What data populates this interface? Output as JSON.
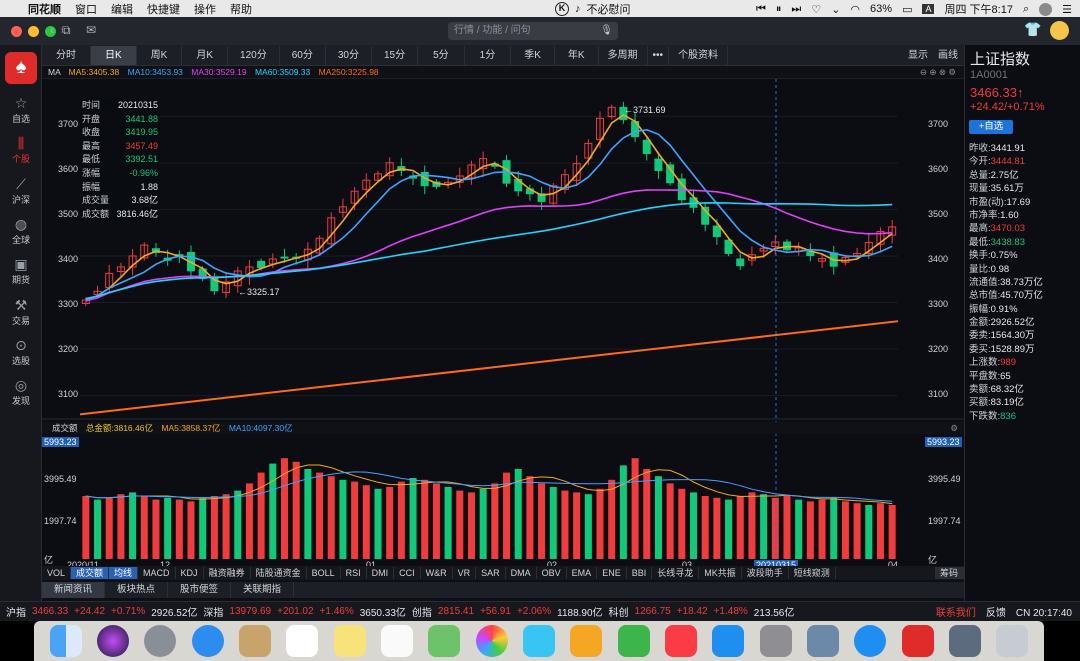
{
  "menubar": {
    "app": "同花顺",
    "items": [
      "窗口",
      "编辑",
      "快捷键",
      "操作",
      "帮助"
    ],
    "center_text": "不必慰问",
    "battery": "63%",
    "input_method": "A",
    "clock": "周四 下午8:17"
  },
  "toolbar": {
    "search_placeholder": "行情 / 功能 / 问句"
  },
  "sidebar": {
    "items": [
      {
        "label": "自选",
        "icon": "star-icon"
      },
      {
        "label": "个股",
        "icon": "candles-icon"
      },
      {
        "label": "沪深",
        "icon": "trend-icon"
      },
      {
        "label": "全球",
        "icon": "globe-icon"
      },
      {
        "label": "期货",
        "icon": "futures-icon"
      },
      {
        "label": "交易",
        "icon": "trade-icon"
      },
      {
        "label": "选股",
        "icon": "chart-select-icon"
      },
      {
        "label": "发现",
        "icon": "compass-icon"
      }
    ]
  },
  "period_tabs": [
    "分时",
    "日K",
    "周K",
    "月K",
    "120分",
    "60分",
    "30分",
    "15分",
    "5分",
    "1分",
    "季K",
    "年K",
    "多周期",
    "•••",
    "个股资料"
  ],
  "tabs_right": [
    "显示",
    "画线"
  ],
  "ma_bar": {
    "label": "MA",
    "items": [
      {
        "text": "MA5:3405.38",
        "color": "#f5a623"
      },
      {
        "text": "MA10:3453.93",
        "color": "#3fa3ff"
      },
      {
        "text": "MA30:3529.19",
        "color": "#e040fb"
      },
      {
        "text": "MA60:3509.33",
        "color": "#21d4fd"
      },
      {
        "text": "MA250:3225.98",
        "color": "#ff6a1a"
      }
    ]
  },
  "info_box": {
    "rows": [
      {
        "k": "时间",
        "v": "20210315",
        "color": "#e6e8eb"
      },
      {
        "k": "开盘",
        "v": "3441.88",
        "color": "#12c97a"
      },
      {
        "k": "收盘",
        "v": "3419.95",
        "color": "#12c97a"
      },
      {
        "k": "最高",
        "v": "3457.49",
        "color": "#f03c3c"
      },
      {
        "k": "最低",
        "v": "3392.51",
        "color": "#12c97a"
      },
      {
        "k": "涨幅",
        "v": "-0.96%",
        "color": "#12c97a"
      },
      {
        "k": "振幅",
        "v": "1.88",
        "color": "#e6e8eb"
      },
      {
        "k": "成交量",
        "v": "3.68亿",
        "color": "#e6e8eb"
      },
      {
        "k": "成交额",
        "v": "3816.46亿",
        "color": "#e6e8eb"
      }
    ]
  },
  "price_axis": [
    "3700",
    "3600",
    "3500",
    "3400",
    "3300",
    "3200",
    "3100"
  ],
  "annotations": {
    "high": "3731.69",
    "low": "3325.17"
  },
  "volume_bar": {
    "label": "成交额",
    "items": [
      {
        "text": "总金额:3816.46亿",
        "color": "#e8c020"
      },
      {
        "text": "MA5:3858.37亿",
        "color": "#f5a623"
      },
      {
        "text": "MA10:4097.30亿",
        "color": "#3fa3ff"
      }
    ]
  },
  "volume_axis": [
    "5993.23",
    "3995.49",
    "1997.74",
    "亿"
  ],
  "date_axis": [
    "2020/11",
    "12",
    "01",
    "02",
    "03",
    "20210315",
    "04"
  ],
  "indicator_tabs": [
    "VOL",
    "成交额",
    "均线",
    "MACD",
    "KDJ",
    "融资融券",
    "陆股通资金",
    "BOLL",
    "RSI",
    "DMI",
    "CCI",
    "W&R",
    "VR",
    "SAR",
    "DMA",
    "OBV",
    "EMA",
    "ENE",
    "BBI",
    "长线寻龙",
    "MK共振",
    "波段助手",
    "短线窥测"
  ],
  "indicator_right": "筹码",
  "news_tabs": [
    "新闻资讯",
    "板块热点",
    "股市便签",
    "关联期指"
  ],
  "right_panel": {
    "title": "上证指数",
    "code": "1A0001",
    "price": "3466.33↑",
    "change": "+24.42/+0.71%",
    "add_button": "+自选",
    "rows": [
      {
        "k": "昨收:",
        "v": "3441.91",
        "color": "#e6e8eb"
      },
      {
        "k": "今开:",
        "v": "3444.81",
        "color": "#f03c3c"
      },
      {
        "k": "总量:",
        "v": "2.75亿",
        "color": "#e6e8eb"
      },
      {
        "k": "现量:",
        "v": "35.61万",
        "color": "#e6e8eb"
      },
      {
        "k": "市盈(动):",
        "v": "17.69",
        "color": "#e6e8eb"
      },
      {
        "k": "市净率:",
        "v": "1.60",
        "color": "#e6e8eb"
      },
      {
        "k": "最高:",
        "v": "3470.03",
        "color": "#f03c3c"
      },
      {
        "k": "最低:",
        "v": "3438.83",
        "color": "#12c97a"
      },
      {
        "k": "换手:",
        "v": "0.75%",
        "color": "#e6e8eb"
      },
      {
        "k": "量比:",
        "v": "0.98",
        "color": "#e6e8eb"
      },
      {
        "k": "流通值:",
        "v": "38.73万亿",
        "color": "#e6e8eb"
      },
      {
        "k": "总市值:",
        "v": "45.70万亿",
        "color": "#e6e8eb"
      },
      {
        "k": "振幅:",
        "v": "0.91%",
        "color": "#e6e8eb"
      },
      {
        "k": "金额:",
        "v": "2926.52亿",
        "color": "#e6e8eb"
      },
      {
        "k": "委卖:",
        "v": "1564.30万",
        "color": "#e6e8eb"
      },
      {
        "k": "委买:",
        "v": "1528.89万",
        "color": "#e6e8eb"
      },
      {
        "k": "上涨数:",
        "v": "989",
        "color": "#f03c3c"
      },
      {
        "k": "平盘数:",
        "v": "65",
        "color": "#e6e8eb"
      },
      {
        "k": "卖额:",
        "v": "68.32亿",
        "color": "#e6e8eb"
      },
      {
        "k": "买额:",
        "v": "83.19亿",
        "color": "#e6e8eb"
      },
      {
        "k": "下跌数:",
        "v": "836",
        "color": "#12c97a"
      }
    ]
  },
  "status_bar": {
    "items": [
      {
        "text": "沪指",
        "color": "#e6e8eb"
      },
      {
        "text": "3466.33",
        "color": "#f03c3c"
      },
      {
        "text": "+24.42",
        "color": "#f03c3c"
      },
      {
        "text": "+0.71%",
        "color": "#f03c3c"
      },
      {
        "text": "2926.52亿",
        "color": "#e6e8eb"
      },
      {
        "text": "深指",
        "color": "#e6e8eb"
      },
      {
        "text": "13979.69",
        "color": "#f03c3c"
      },
      {
        "text": "+201.02",
        "color": "#f03c3c"
      },
      {
        "text": "+1.46%",
        "color": "#f03c3c"
      },
      {
        "text": "3650.33亿",
        "color": "#e6e8eb"
      },
      {
        "text": "创指",
        "color": "#e6e8eb"
      },
      {
        "text": "2815.41",
        "color": "#f03c3c"
      },
      {
        "text": "+56.91",
        "color": "#f03c3c"
      },
      {
        "text": "+2.06%",
        "color": "#f03c3c"
      },
      {
        "text": "1188.90亿",
        "color": "#e6e8eb"
      },
      {
        "text": "科创",
        "color": "#e6e8eb"
      },
      {
        "text": "1266.75",
        "color": "#f03c3c"
      },
      {
        "text": "+18.42",
        "color": "#f03c3c"
      },
      {
        "text": "+1.48%",
        "color": "#f03c3c"
      },
      {
        "text": "213.56亿",
        "color": "#e6e8eb"
      }
    ],
    "right": [
      {
        "text": "联系我们",
        "color": "#f03c3c"
      },
      {
        "text": "反馈",
        "color": "#e6e8eb"
      },
      {
        "text": "CN 20:17:40",
        "color": "#e6e8eb"
      }
    ]
  },
  "chart_data": {
    "type": "candlestick",
    "x_range": [
      "2020/11",
      "2021/04"
    ],
    "ylim": [
      3050,
      3780
    ],
    "price_path": [
      3310,
      3325,
      3360,
      3380,
      3400,
      3420,
      3410,
      3390,
      3395,
      3370,
      3350,
      3330,
      3345,
      3365,
      3380,
      3375,
      3390,
      3400,
      3395,
      3410,
      3440,
      3480,
      3510,
      3540,
      3560,
      3580,
      3600,
      3580,
      3570,
      3550,
      3545,
      3560,
      3570,
      3600,
      3610,
      3590,
      3560,
      3540,
      3530,
      3520,
      3550,
      3570,
      3600,
      3640,
      3700,
      3720,
      3690,
      3660,
      3620,
      3580,
      3560,
      3520,
      3500,
      3470,
      3440,
      3410,
      3380,
      3400,
      3420,
      3430,
      3410,
      3420,
      3400,
      3390,
      3380,
      3395,
      3410,
      3430,
      3450,
      3466
    ],
    "ma250": [
      3060,
      3260
    ],
    "volume_path": [
      3500,
      3300,
      3400,
      3600,
      3700,
      3500,
      3300,
      3400,
      3300,
      3200,
      3400,
      3500,
      3600,
      3800,
      4200,
      4800,
      5300,
      5600,
      5400,
      5000,
      4800,
      4600,
      4400,
      4300,
      4100,
      3900,
      4000,
      4300,
      4500,
      4400,
      4200,
      4000,
      3800,
      3700,
      3900,
      4200,
      4800,
      5000,
      4600,
      4200,
      4000,
      3800,
      3700,
      3600,
      3900,
      4400,
      5200,
      5600,
      5000,
      4600,
      4200,
      3900,
      3700,
      3500,
      3400,
      3300,
      3500,
      3700,
      3600,
      3400,
      3500,
      3300,
      3200,
      3300,
      3400,
      3200,
      3100,
      3000,
      3100,
      3000
    ]
  }
}
